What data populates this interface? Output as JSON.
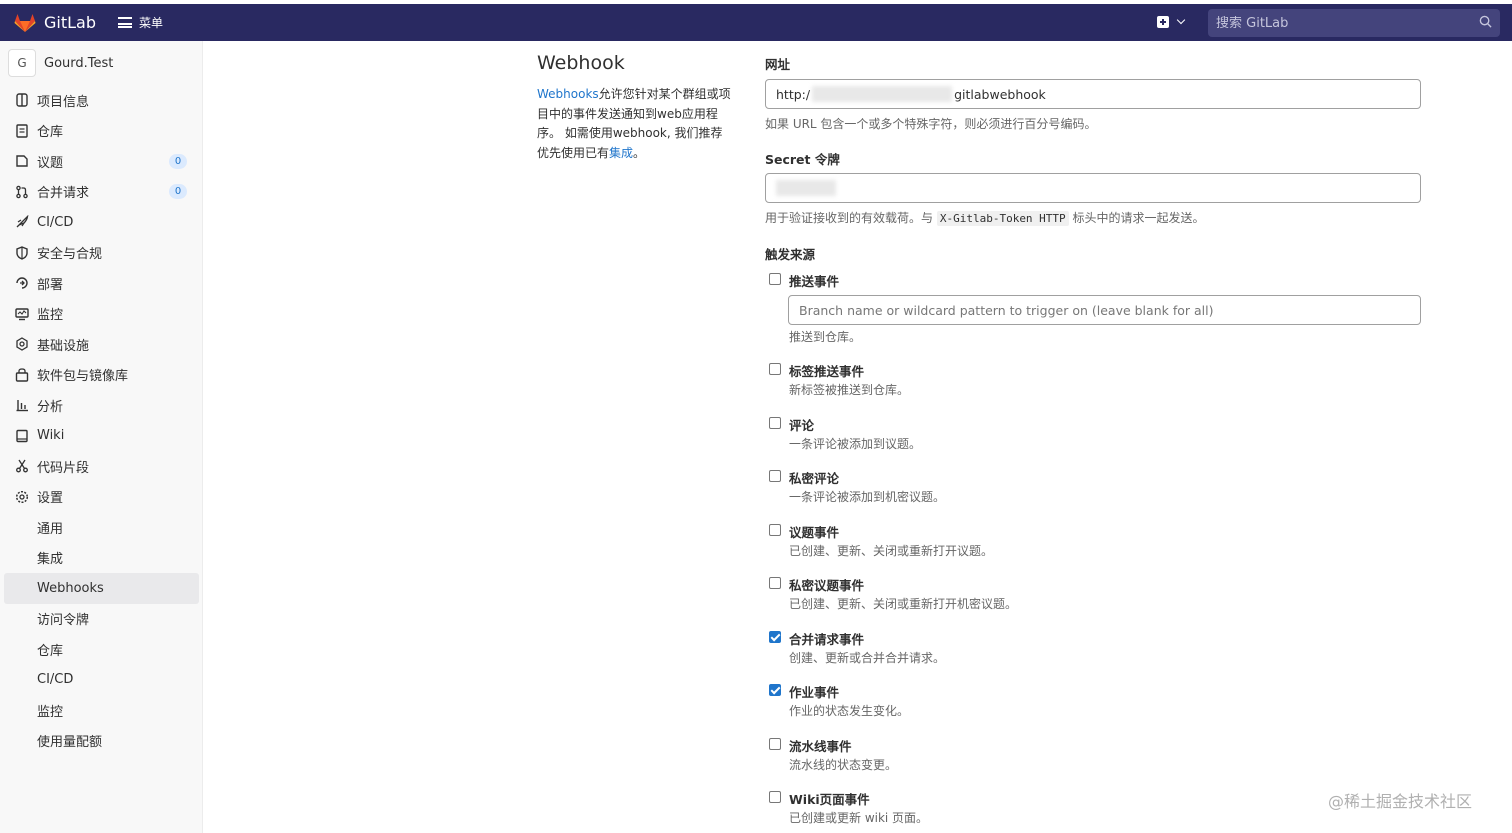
{
  "topbar": {
    "brand": "GitLab",
    "menu_label": "菜单",
    "search_placeholder": "搜索 GitLab",
    "colors": {
      "background": "#292961",
      "search_bg": "#44447c"
    }
  },
  "sidebar": {
    "project_avatar": "G",
    "project_name": "Gourd.Test",
    "items": [
      {
        "label": "项目信息",
        "icon": "info-icon"
      },
      {
        "label": "仓库",
        "icon": "repository-icon"
      },
      {
        "label": "议题",
        "icon": "issues-icon",
        "count": "0"
      },
      {
        "label": "合并请求",
        "icon": "merge-request-icon",
        "count": "0"
      },
      {
        "label": "CI/CD",
        "icon": "rocket-icon"
      },
      {
        "label": "安全与合规",
        "icon": "shield-icon"
      },
      {
        "label": "部署",
        "icon": "deployments-icon"
      },
      {
        "label": "监控",
        "icon": "monitor-icon"
      },
      {
        "label": "基础设施",
        "icon": "cloud-gear-icon"
      },
      {
        "label": "软件包与镜像库",
        "icon": "package-icon"
      },
      {
        "label": "分析",
        "icon": "chart-icon"
      },
      {
        "label": "Wiki",
        "icon": "book-icon"
      },
      {
        "label": "代码片段",
        "icon": "scissors-icon"
      },
      {
        "label": "设置",
        "icon": "settings-icon"
      }
    ],
    "settings_sub": [
      "通用",
      "集成",
      "Webhooks",
      "访问令牌",
      "仓库",
      "CI/CD",
      "监控",
      "使用量配额"
    ],
    "active_sub": "Webhooks"
  },
  "lead": {
    "title": "Webhook",
    "link1": "Webhooks",
    "text1": "允许您针对某个群组或项目中的事件发送通知到web应用程序。 如需使用webhook, 我们推荐优先使用已有",
    "link2": "集成",
    "text2": "。"
  },
  "form": {
    "url_label": "网址",
    "url_prefix": "http:/",
    "url_suffix": "gitlabwebhook",
    "url_help": "如果 URL 包含一个或多个特殊字符，则必须进行百分号编码。",
    "secret_label": "Secret 令牌",
    "secret_help_before": "用于验证接收到的有效载荷。与",
    "secret_help_code": "X-Gitlab-Token HTTP",
    "secret_help_after": "标头中的请求一起发送。",
    "trigger_label": "触发来源",
    "branch_placeholder": "Branch name or wildcard pattern to trigger on (leave blank for all)",
    "push_label": "推送事件",
    "push_checked": false,
    "push_help": "推送到仓库。",
    "triggers": [
      {
        "label": "标签推送事件",
        "help": "新标签被推送到仓库。",
        "checked": false
      },
      {
        "label": "评论",
        "help": "一条评论被添加到议题。",
        "checked": false
      },
      {
        "label": "私密评论",
        "help": "一条评论被添加到机密议题。",
        "checked": false
      },
      {
        "label": "议题事件",
        "help": "已创建、更新、关闭或重新打开议题。",
        "checked": false
      },
      {
        "label": "私密议题事件",
        "help": "已创建、更新、关闭或重新打开机密议题。",
        "checked": false
      },
      {
        "label": "合并请求事件",
        "help": "创建、更新或合并合并请求。",
        "checked": true
      },
      {
        "label": "作业事件",
        "help": "作业的状态发生变化。",
        "checked": true
      },
      {
        "label": "流水线事件",
        "help": "流水线的状态变更。",
        "checked": false
      },
      {
        "label": "Wiki页面事件",
        "help": "已创建或更新 wiki 页面。",
        "checked": false
      }
    ],
    "accent": "#1f75cb"
  },
  "watermark": "@稀土掘金技术社区"
}
